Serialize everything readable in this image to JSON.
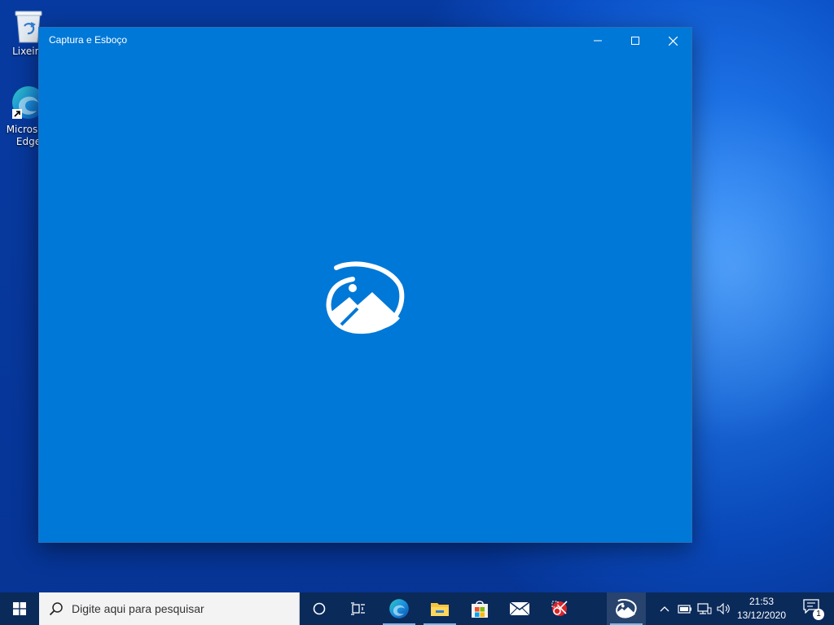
{
  "desktop": {
    "icons": [
      {
        "label": "Lixeira",
        "icon": "recycle-bin-icon"
      },
      {
        "label": "Microsoft Edge",
        "icon": "edge-icon"
      }
    ]
  },
  "window": {
    "title": "Captura e Esboço",
    "controls": [
      "minimize-icon",
      "maximize-icon",
      "close-icon"
    ],
    "background": "#0078d7",
    "splash_icon": "snip-sketch-icon"
  },
  "taskbar": {
    "search_placeholder": "Digite aqui para pesquisar",
    "pinned": [
      {
        "name": "cortana",
        "icon": "circle-icon"
      },
      {
        "name": "task-view",
        "icon": "task-view-icon"
      },
      {
        "name": "edge",
        "icon": "edge-icon",
        "running": true
      },
      {
        "name": "file-explorer",
        "icon": "folder-icon",
        "running": true
      },
      {
        "name": "store",
        "icon": "store-icon"
      },
      {
        "name": "mail",
        "icon": "mail-icon"
      },
      {
        "name": "snip-tool",
        "icon": "snip-icon"
      },
      {
        "name": "snip-sketch",
        "icon": "snip-sketch-icon",
        "running": true,
        "active": true
      }
    ],
    "tray": {
      "icons": [
        "chevron-up-icon",
        "battery-icon",
        "network-icon",
        "volume-icon"
      ],
      "time": "21:53",
      "date": "13/12/2020",
      "notification_count": "1"
    }
  },
  "colors": {
    "accent": "#0078d7",
    "taskbar": "#0a2a5a"
  }
}
